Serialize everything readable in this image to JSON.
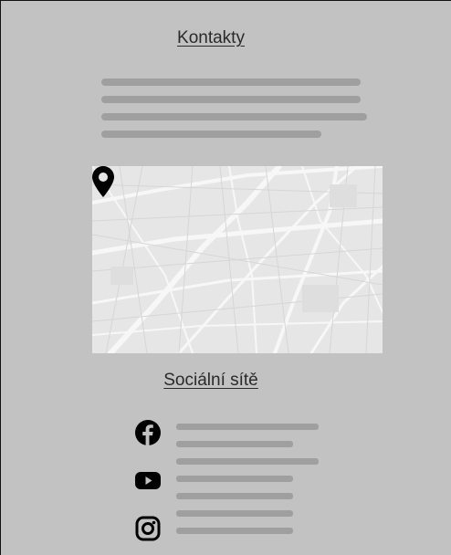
{
  "contacts": {
    "title": "Kontakty"
  },
  "map": {
    "pin_icon": "map-pin-icon"
  },
  "social": {
    "title": "Sociální sítě",
    "items": [
      {
        "icon": "facebook-icon"
      },
      {
        "icon": "youtube-icon"
      },
      {
        "icon": "instagram-icon"
      }
    ]
  },
  "colors": {
    "background": "#c2c2c2",
    "placeholder_bar": "#9f9f9f",
    "map_base": "#e6e6e6",
    "icon": "#000000"
  }
}
